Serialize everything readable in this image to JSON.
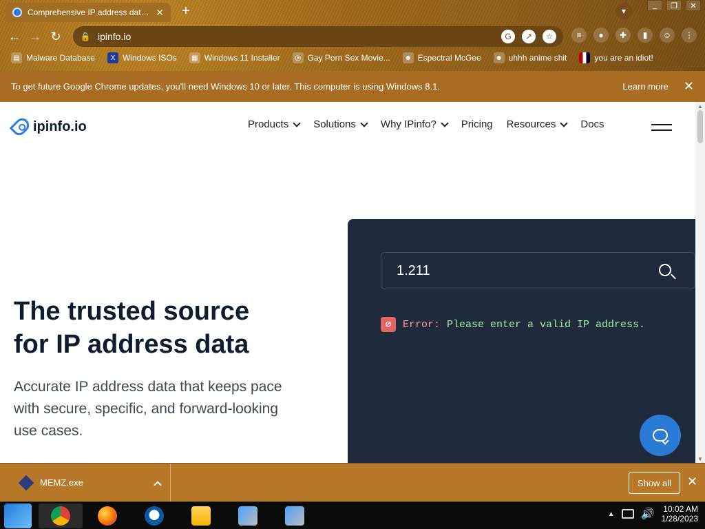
{
  "browser": {
    "tab": {
      "title": "Comprehensive IP address data, I",
      "close": "✕"
    },
    "new_tab": "+",
    "url": "ipinfo.io",
    "bookmarks": [
      {
        "label": "Malware Database",
        "icon": "folder-icon"
      },
      {
        "label": "Windows ISOs",
        "icon": "x-icon"
      },
      {
        "label": "Windows 11 Installer",
        "icon": "image-icon"
      },
      {
        "label": "Gay Porn Sex Movie...",
        "icon": "globe-icon"
      },
      {
        "label": "Espectral McGee",
        "icon": "avatar-icon"
      },
      {
        "label": "uhhh anime shit",
        "icon": "avatar-icon"
      },
      {
        "label": "you are an idiot!",
        "icon": "flag-icon"
      }
    ]
  },
  "update_banner": {
    "message": "To get future Google Chrome updates, you'll need Windows 10 or later. This computer is using Windows 8.1.",
    "learn_more": "Learn more",
    "close": "✕"
  },
  "site": {
    "logo_text": "ipinfo.io",
    "nav": [
      {
        "label": "Products",
        "dropdown": true
      },
      {
        "label": "Solutions",
        "dropdown": true
      },
      {
        "label": "Why IPinfo?",
        "dropdown": true
      },
      {
        "label": "Pricing",
        "dropdown": false
      },
      {
        "label": "Resources",
        "dropdown": true
      },
      {
        "label": "Docs",
        "dropdown": false
      }
    ],
    "hero_title_line1": "The trusted source",
    "hero_title_line2": "for IP address data",
    "hero_text": "Accurate IP address data that keeps pace with secure, specific, and forward-looking use cases.",
    "lookup_value": "1.211",
    "error_label": "Error:",
    "error_message": "Please enter a valid IP address."
  },
  "download_bar": {
    "file": "MEMZ.exe",
    "show_all": "Show all",
    "close": "✕"
  },
  "taskbar": {
    "time": "10:02 AM",
    "date": "1/28/2023"
  }
}
